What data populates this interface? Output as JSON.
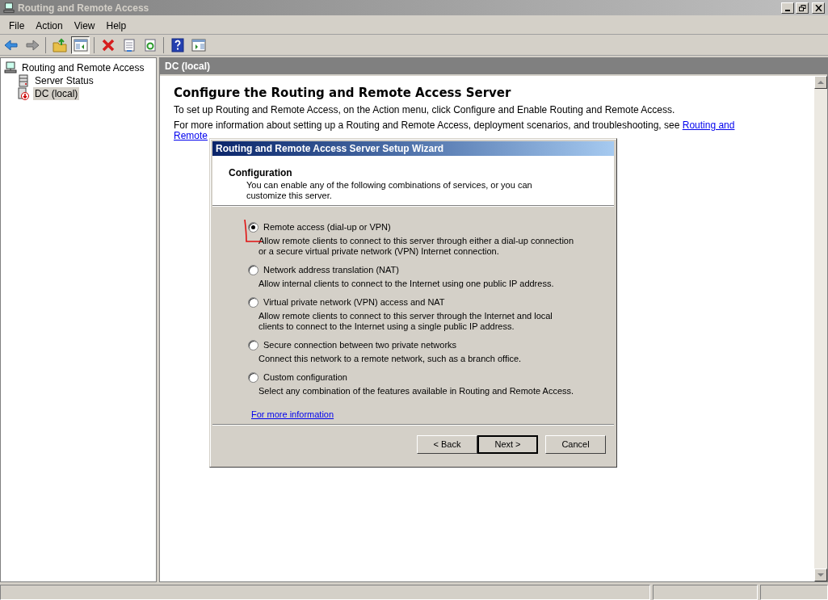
{
  "window": {
    "title": "Routing and Remote Access"
  },
  "menu": [
    "File",
    "Action",
    "View",
    "Help"
  ],
  "toolbar": [
    {
      "kind": "back",
      "pressed": false
    },
    {
      "kind": "forward",
      "pressed": false
    },
    {
      "kind": "sep"
    },
    {
      "kind": "up",
      "pressed": false
    },
    {
      "kind": "tree",
      "pressed": true
    },
    {
      "kind": "sep"
    },
    {
      "kind": "delete",
      "pressed": false
    },
    {
      "kind": "properties",
      "pressed": false
    },
    {
      "kind": "refresh",
      "pressed": false
    },
    {
      "kind": "sep"
    },
    {
      "kind": "help",
      "pressed": false
    },
    {
      "kind": "actionpane",
      "pressed": false
    }
  ],
  "tree": [
    {
      "label": "Routing and Remote Access",
      "kind": "root",
      "selected": false,
      "children": [
        {
          "label": "Server Status",
          "kind": "status",
          "selected": false
        },
        {
          "label": "DC (local)",
          "kind": "server",
          "selected": true
        }
      ]
    }
  ],
  "content": {
    "header": "DC (local)",
    "heading": "Configure the Routing and Remote Access Server",
    "paragraph": "To set up Routing and Remote Access, on the Action menu, click Configure and Enable Routing and Remote Access.",
    "more_text": "For more information about setting up a Routing and Remote Access, deployment scenarios, and troubleshooting, see",
    "link_lines": [
      "Routing and",
      "Remote"
    ]
  },
  "dialog": {
    "title": "Routing and Remote Access Server Setup Wizard",
    "section_title": "Configuration",
    "section_text": "You can enable any of the following combinations of services, or you can customize this server.",
    "options": [
      {
        "label": "Remote access (dial-up or VPN)",
        "description": "Allow remote clients to connect to this server through either a dial-up connection or a secure virtual private network (VPN) Internet connection.",
        "selected": true
      },
      {
        "label": "Network address translation (NAT)",
        "description": "Allow internal clients to connect to the Internet using one public IP address.",
        "selected": false
      },
      {
        "label": "Virtual private network (VPN) access and NAT",
        "description": "Allow remote clients to connect to this server through the Internet and local clients to connect to the Internet using a single public IP address.",
        "selected": false
      },
      {
        "label": "Secure connection between two private networks",
        "description": "Connect this network to a remote network, such as a branch office.",
        "selected": false
      },
      {
        "label": "Custom configuration",
        "description": "Select any combination of the features available in Routing and Remote Access.",
        "selected": false
      }
    ],
    "more_link": "For more information",
    "buttons": [
      {
        "label": "< Back",
        "default": false
      },
      {
        "label": "Next >",
        "default": true
      },
      {
        "label": "Cancel",
        "default": false
      }
    ]
  }
}
